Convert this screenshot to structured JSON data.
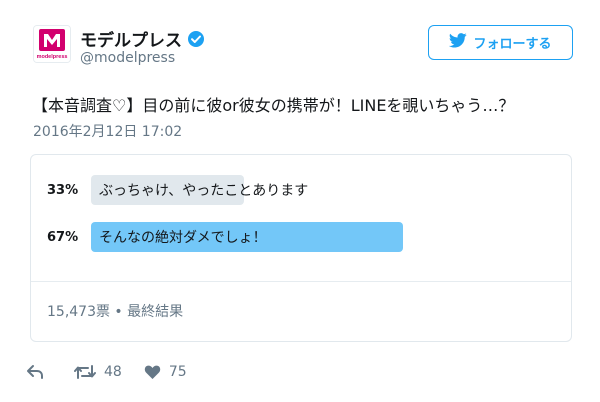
{
  "user": {
    "display_name": "モデルプレス",
    "handle": "@modelpress",
    "avatar_text": "modelpress",
    "verified_icon": "verified-badge-icon"
  },
  "follow_button": {
    "label": "フォローする",
    "icon": "bird-icon"
  },
  "tweet": {
    "text": "【本音調査♡】目の前に彼or彼女の携帯が！LINEを覗いちゃう…？",
    "timestamp": "2016年2月12日 17:02"
  },
  "poll": {
    "options": [
      {
        "percent_label": "33%",
        "label": "ぶっちゃけ、やったことあります",
        "percent": 33
      },
      {
        "percent_label": "67%",
        "label": "そんなの絶対ダメでしょ！",
        "percent": 67
      }
    ],
    "meta": "15,473票 • 最終結果"
  },
  "actions": {
    "reply_icon": "reply-icon",
    "retweet_icon": "retweet-icon",
    "retweet_count": "48",
    "like_icon": "heart-icon",
    "like_count": "75"
  },
  "colors": {
    "brand_blue": "#1da1f2",
    "winner_bar": "#73c7f8",
    "loser_bar": "#e1e8ed",
    "avatar_magenta": "#d2006e"
  }
}
